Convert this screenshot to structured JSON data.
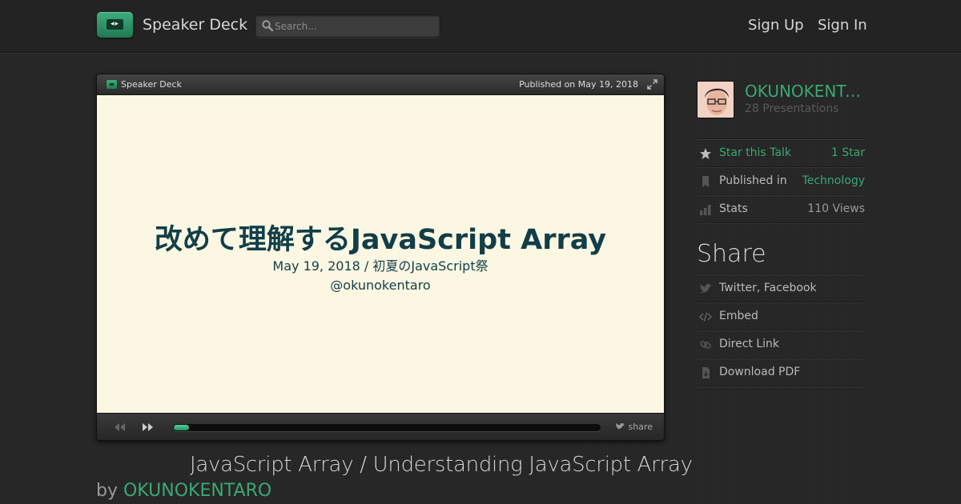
{
  "header": {
    "brand": "Speaker Deck",
    "search_placeholder": "Search...",
    "sign_up": "Sign Up",
    "sign_in": "Sign In"
  },
  "player": {
    "brand": "Speaker Deck",
    "published": "Published on May 19, 2018",
    "slide": {
      "title": "改めて理解するJavaScript Array",
      "subtitle_line1": "May 19, 2018 / 初夏のJavaScript祭",
      "subtitle_line2": "@okunokentaro"
    },
    "progress": 0.035,
    "share_label": "share"
  },
  "talk": {
    "title": "JavaScript Array / Understanding JavaScript Array",
    "by": "by",
    "author": "OKUNOKENTARO"
  },
  "sidebar": {
    "author_name": "OKUNOKENTARO",
    "author_presentations": "28 Presentations",
    "rows": [
      {
        "label": "Star this Talk",
        "value": "1 Star",
        "icon": "star-icon"
      },
      {
        "label": "Published in",
        "value": "Technology",
        "icon": "bookmark-icon"
      },
      {
        "label": "Stats",
        "value": "110 Views",
        "icon": "stats-icon"
      }
    ],
    "share_heading": "Share",
    "share_rows": [
      {
        "label": "Twitter, Facebook",
        "icon": "twitter-icon"
      },
      {
        "label": "Embed",
        "icon": "code-icon"
      },
      {
        "label": "Direct Link",
        "icon": "link-icon"
      },
      {
        "label": "Download PDF",
        "icon": "download-icon"
      }
    ]
  },
  "colors": {
    "accent": "#3aa875",
    "slide_bg": "#fcf7e2",
    "slide_text": "#113e48"
  }
}
